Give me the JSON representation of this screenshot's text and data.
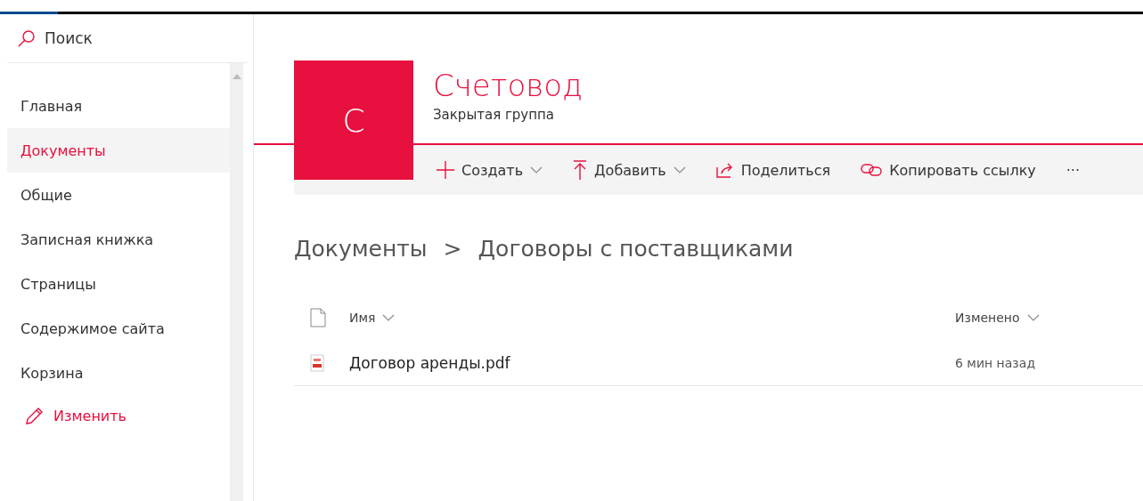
{
  "search": {
    "placeholder": "Поиск"
  },
  "nav": [
    {
      "label": "Главная",
      "selected": false
    },
    {
      "label": "Документы",
      "selected": true
    },
    {
      "label": "Общие",
      "selected": false
    },
    {
      "label": "Записная книжка",
      "selected": false
    },
    {
      "label": "Страницы",
      "selected": false
    },
    {
      "label": "Содержимое сайта",
      "selected": false
    },
    {
      "label": "Корзина",
      "selected": false
    }
  ],
  "edit_link": "Изменить",
  "site": {
    "logo_letter": "C",
    "title": "Счетовод",
    "subtitle": "Закрытая группа"
  },
  "toolbar": [
    {
      "kind": "new",
      "label": "Создать",
      "dropdown": true
    },
    {
      "kind": "upload",
      "label": "Добавить",
      "dropdown": true
    },
    {
      "kind": "share",
      "label": "Поделиться",
      "dropdown": false
    },
    {
      "kind": "link",
      "label": "Копировать ссылку",
      "dropdown": false
    },
    {
      "kind": "more",
      "label": "···",
      "dropdown": false
    }
  ],
  "breadcrumb": [
    "Документы",
    "Договоры с поставщиками"
  ],
  "breadcrumb_separator": ">",
  "table": {
    "columns": [
      "Имя",
      "Изменено"
    ],
    "rows": [
      {
        "name": "Договор аренды.pdf",
        "modified": "6 мин назад"
      }
    ]
  }
}
